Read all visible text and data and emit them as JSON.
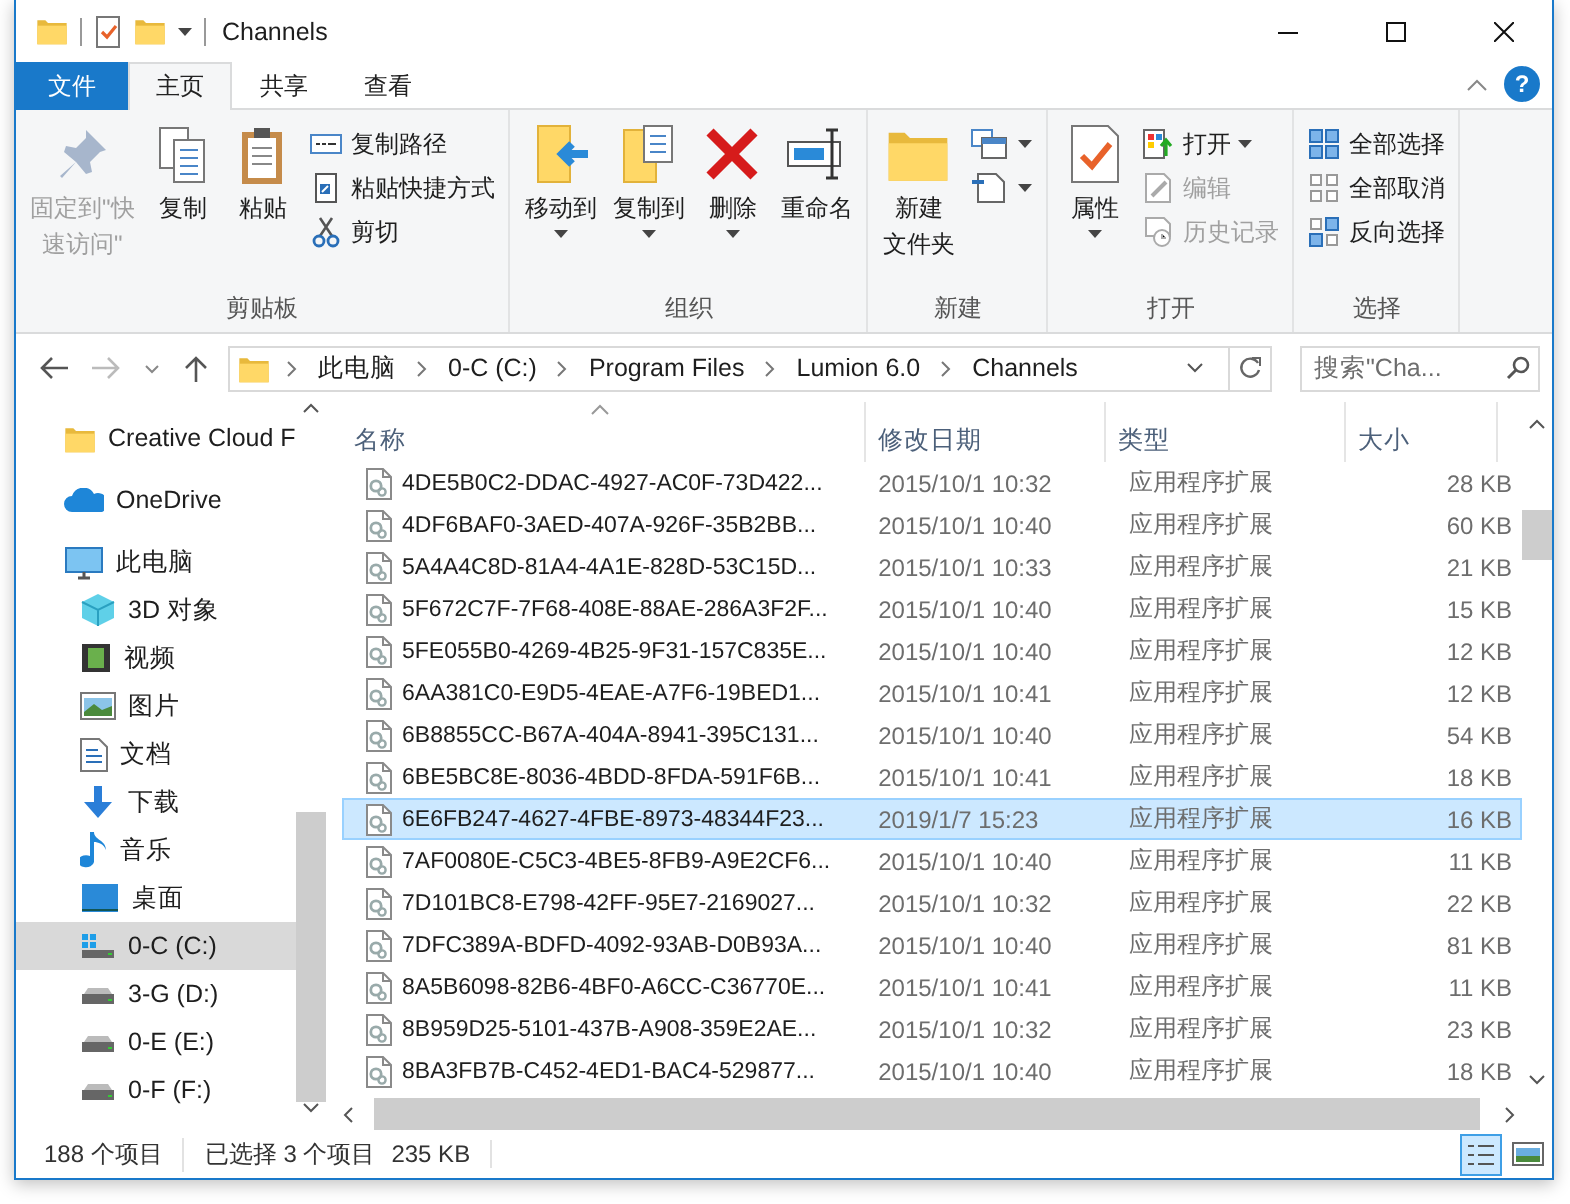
{
  "window": {
    "title": "Channels"
  },
  "tabs": [
    {
      "label": "文件",
      "kind": "file",
      "selected": false
    },
    {
      "label": "主页",
      "kind": "normal",
      "selected": true
    },
    {
      "label": "共享",
      "kind": "normal",
      "selected": false
    },
    {
      "label": "查看",
      "kind": "normal",
      "selected": false
    }
  ],
  "help_button": {
    "label": "?"
  },
  "ribbon": {
    "groups": [
      {
        "label": "剪贴板",
        "items": [
          {
            "kind": "large",
            "lines": [
              "固定到\"快",
              "速访问\""
            ],
            "disabled": true,
            "dropdown": false
          },
          {
            "kind": "large",
            "label": "复制",
            "disabled": false,
            "dropdown": false
          },
          {
            "kind": "large",
            "label": "粘贴",
            "disabled": false,
            "dropdown": false
          },
          {
            "kind": "small",
            "label": "复制路径",
            "disabled": false,
            "dropdown": false
          },
          {
            "kind": "small",
            "label": "粘贴快捷方式",
            "disabled": false,
            "dropdown": false
          },
          {
            "kind": "small",
            "label": "剪切",
            "disabled": false,
            "dropdown": false
          }
        ]
      },
      {
        "label": "组织",
        "items": [
          {
            "kind": "large",
            "label": "移动到",
            "disabled": false,
            "dropdown": true
          },
          {
            "kind": "large",
            "label": "复制到",
            "disabled": false,
            "dropdown": true
          },
          {
            "kind": "large",
            "label": "删除",
            "disabled": false,
            "dropdown": true
          },
          {
            "kind": "large",
            "label": "重命名",
            "disabled": false,
            "dropdown": false
          }
        ]
      },
      {
        "label": "新建",
        "items": [
          {
            "kind": "large",
            "lines": [
              "新建",
              "文件夹"
            ],
            "disabled": false,
            "dropdown": false
          },
          {
            "kind": "small",
            "disabled": false,
            "dropdown": true
          },
          {
            "kind": "small",
            "disabled": false,
            "dropdown": true
          }
        ]
      },
      {
        "label": "打开",
        "items": [
          {
            "kind": "large",
            "label": "属性",
            "disabled": false,
            "dropdown": true
          },
          {
            "kind": "small",
            "label": "打开",
            "disabled": false,
            "dropdown": true
          },
          {
            "kind": "small",
            "label": "编辑",
            "disabled": true,
            "dropdown": false
          },
          {
            "kind": "small",
            "label": "历史记录",
            "disabled": true,
            "dropdown": false
          }
        ]
      },
      {
        "label": "选择",
        "items": [
          {
            "kind": "small",
            "label": "全部选择",
            "disabled": false,
            "dropdown": false
          },
          {
            "kind": "small",
            "label": "全部取消",
            "disabled": false,
            "dropdown": false
          },
          {
            "kind": "small",
            "label": "反向选择",
            "disabled": false,
            "dropdown": false
          }
        ]
      }
    ]
  },
  "address": {
    "crumbs": [
      "此电脑",
      "0-C (C:)",
      "Program Files",
      "Lumion 6.0",
      "Channels"
    ],
    "search_placeholder": "搜索\"Cha..."
  },
  "sidebar": {
    "items": [
      {
        "label": "Creative Cloud F",
        "selected": false
      },
      {
        "label": "OneDrive",
        "selected": false
      },
      {
        "label": "此电脑",
        "selected": false,
        "children": [
          {
            "label": "3D 对象",
            "selected": false
          },
          {
            "label": "视频",
            "selected": false
          },
          {
            "label": "图片",
            "selected": false
          },
          {
            "label": "文档",
            "selected": false
          },
          {
            "label": "下载",
            "selected": false
          },
          {
            "label": "音乐",
            "selected": false
          },
          {
            "label": "桌面",
            "selected": false
          },
          {
            "label": "0-C (C:)",
            "selected": true
          },
          {
            "label": "3-G (D:)",
            "selected": false
          },
          {
            "label": "0-E (E:)",
            "selected": false
          },
          {
            "label": "0-F (F:)",
            "selected": false
          }
        ]
      }
    ]
  },
  "table": {
    "columns": [
      {
        "label": "名称",
        "sorted": true
      },
      {
        "label": "修改日期",
        "sorted": false
      },
      {
        "label": "类型",
        "sorted": false
      },
      {
        "label": "大小",
        "sorted": false
      }
    ],
    "rows": [
      {
        "name": "4DE5B0C2-DDAC-4927-AC0F-73D422...",
        "date": "2015/10/1 10:32",
        "type": "应用程序扩展",
        "size": "28 KB",
        "selected": false
      },
      {
        "name": "4DF6BAF0-3AED-407A-926F-35B2BB...",
        "date": "2015/10/1 10:40",
        "type": "应用程序扩展",
        "size": "60 KB",
        "selected": false
      },
      {
        "name": "5A4A4C8D-81A4-4A1E-828D-53C15D...",
        "date": "2015/10/1 10:33",
        "type": "应用程序扩展",
        "size": "21 KB",
        "selected": false
      },
      {
        "name": "5F672C7F-7F68-408E-88AE-286A3F2F...",
        "date": "2015/10/1 10:40",
        "type": "应用程序扩展",
        "size": "15 KB",
        "selected": false
      },
      {
        "name": "5FE055B0-4269-4B25-9F31-157C835E...",
        "date": "2015/10/1 10:40",
        "type": "应用程序扩展",
        "size": "12 KB",
        "selected": false
      },
      {
        "name": "6AA381C0-E9D5-4EAE-A7F6-19BED1...",
        "date": "2015/10/1 10:41",
        "type": "应用程序扩展",
        "size": "12 KB",
        "selected": false
      },
      {
        "name": "6B8855CC-B67A-404A-8941-395C131...",
        "date": "2015/10/1 10:40",
        "type": "应用程序扩展",
        "size": "54 KB",
        "selected": false
      },
      {
        "name": "6BE5BC8E-8036-4BDD-8FDA-591F6B...",
        "date": "2015/10/1 10:41",
        "type": "应用程序扩展",
        "size": "18 KB",
        "selected": false
      },
      {
        "name": "6E6FB247-4627-4FBE-8973-48344F23...",
        "date": "2019/1/7 15:23",
        "type": "应用程序扩展",
        "size": "16 KB",
        "selected": true
      },
      {
        "name": "7AF0080E-C5C3-4BE5-8FB9-A9E2CF6...",
        "date": "2015/10/1 10:40",
        "type": "应用程序扩展",
        "size": "11 KB",
        "selected": false
      },
      {
        "name": "7D101BC8-E798-42FF-95E7-2169027...",
        "date": "2015/10/1 10:32",
        "type": "应用程序扩展",
        "size": "22 KB",
        "selected": false
      },
      {
        "name": "7DFC389A-BDFD-4092-93AB-D0B93A...",
        "date": "2015/10/1 10:40",
        "type": "应用程序扩展",
        "size": "81 KB",
        "selected": false
      },
      {
        "name": "8A5B6098-82B6-4BF0-A6CC-C36770E...",
        "date": "2015/10/1 10:41",
        "type": "应用程序扩展",
        "size": "11 KB",
        "selected": false
      },
      {
        "name": "8B959D25-5101-437B-A908-359E2AE...",
        "date": "2015/10/1 10:32",
        "type": "应用程序扩展",
        "size": "23 KB",
        "selected": false
      },
      {
        "name": "8BA3FB7B-C452-4ED1-BAC4-529877...",
        "date": "2015/10/1 10:40",
        "type": "应用程序扩展",
        "size": "18 KB",
        "selected": false
      }
    ]
  },
  "status_bar": {
    "count": "188 个项目",
    "selection": "已选择 3 个项目",
    "selection_size": "235 KB",
    "views": [
      {
        "selected": true
      },
      {
        "selected": false
      }
    ]
  }
}
